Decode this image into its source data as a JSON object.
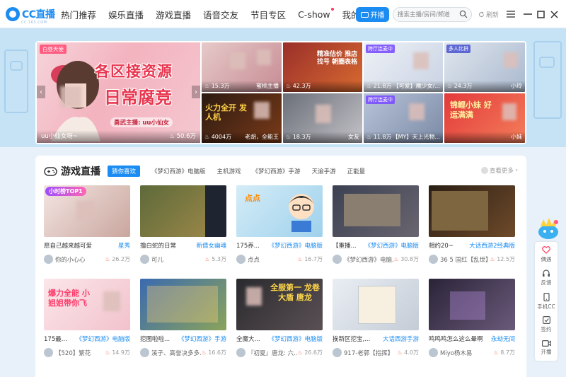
{
  "app": {
    "logo_text": "CC直播",
    "logo_sub": "CC.163.COM",
    "nav": [
      "热门推荐",
      "娱乐直播",
      "游戏直播",
      "语音交友",
      "节目专区",
      "C-show",
      "我的关注"
    ],
    "live_button": "开播",
    "search_placeholder": "搜索主播/房间/频道",
    "refresh_label": "刷新",
    "accent_color": "#1b8cf2"
  },
  "banner": {
    "hero": {
      "badge": "白昼天使",
      "title_line1": "各区接资源",
      "title_line2": "日常腐竞",
      "subtitle": "勇武主播: uu小仙女",
      "streamer": "uu小仙女呀~",
      "views": "50.6万"
    },
    "tiles": [
      {
        "views": "15.3万",
        "name": "蜜桃主播",
        "badge": ""
      },
      {
        "views": "42.3万",
        "name": "",
        "badge": "",
        "text": "精准估价 推店找号 朝圈表格"
      },
      {
        "views": "21.8万",
        "name": "【可爱】魔少女/...",
        "badge": "跨厅连麦中"
      },
      {
        "views": "24.3万",
        "name": "小玲",
        "badge": "多人比拼"
      },
      {
        "views": "4004万",
        "name": "老胡，全能王",
        "badge": "",
        "text": "火力全开 发人机"
      },
      {
        "views": "18.3万",
        "name": "女友",
        "badge": ""
      },
      {
        "views": "11.8万",
        "name": "【MY】天上光物...",
        "badge": "跨厅连麦中"
      },
      {
        "views": "",
        "name": "小妹",
        "badge": "",
        "text": "锦鲤小妹 好运满满"
      }
    ]
  },
  "section": {
    "icon": "gamepad-icon",
    "title": "游戏直播",
    "chips": [
      "猜你喜欢",
      "《梦幻西游》电脑版",
      "主机游戏",
      "《梦幻西游》手游",
      "天谕手游",
      "正能量"
    ],
    "more": "查看更多"
  },
  "cards": [
    {
      "title": "愿自己越来越可爱",
      "category": "星秀",
      "anchor": "你的小心心",
      "views": "26.2万",
      "overlay": "小时榜TOP1"
    },
    {
      "title": "撸白蛇的日常",
      "category": "新倩女幽魂",
      "anchor": "可儿",
      "views": "5.3万",
      "overlay": ""
    },
    {
      "title": "175养...",
      "category": "《梦幻西游》电脑版",
      "anchor": "点点",
      "views": "16.7万",
      "overlay": "点点"
    },
    {
      "title": "【重播...",
      "category": "《梦幻西游》电脑版",
      "anchor": "《梦幻西游》电脑...",
      "views": "30.8万",
      "overlay": ""
    },
    {
      "title": "相约20~",
      "category": "大话西游2经典版",
      "anchor": "36 5 国红【乱世】",
      "views": "12.5万",
      "overlay": ""
    },
    {
      "title": "175最...",
      "category": "《梦幻西游》电脑版",
      "anchor": "【520】繁花",
      "views": "14.9万",
      "overlay": "爆力全能 小姐姐带你飞"
    },
    {
      "title": "挖图啦啦...",
      "category": "《梦幻西游》手游",
      "anchor": "溪子、高誉决多多...",
      "views": "16.6万",
      "overlay": ""
    },
    {
      "title": "全魔大...",
      "category": "《梦幻西游》电脑版",
      "anchor": "『初夏』唐龙: 六...",
      "views": "26.6万",
      "overlay": "全服第一 龙卷大盾 唐龙"
    },
    {
      "title": "挨新区挖宝,...",
      "category": "大话西游手游",
      "anchor": "917-老郭【指挥】",
      "views": "4.0万",
      "overlay": ""
    },
    {
      "title": "鸣鸣鸣怎么这么晕啊",
      "category": "永劫无间",
      "anchor": "Miyo杨木易",
      "views": "8.7万",
      "overlay": ""
    }
  ],
  "sidebar": [
    {
      "icon": "heart-icon",
      "label": "偶遇"
    },
    {
      "icon": "headset-icon",
      "label": "反馈"
    },
    {
      "icon": "phone-icon",
      "label": "手机CC"
    },
    {
      "icon": "checkin-icon",
      "label": "签约"
    },
    {
      "icon": "camera-icon",
      "label": "开播"
    }
  ]
}
